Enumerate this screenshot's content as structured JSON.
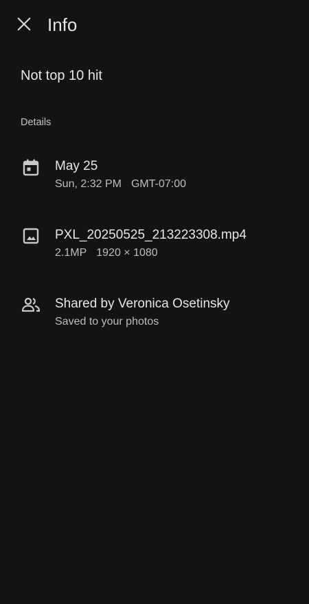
{
  "header": {
    "title": "Info",
    "close_icon": "close-icon"
  },
  "caption": "Not top 10 hit",
  "details": {
    "label": "Details",
    "date": {
      "icon": "calendar-icon",
      "primary": "May 25",
      "time": "Sun, 2:32 PM",
      "timezone": "GMT-07:00"
    },
    "file": {
      "icon": "image-icon",
      "primary": "PXL_20250525_213223308.mp4",
      "megapixels": "2.1MP",
      "resolution": "1920 × 1080"
    },
    "sharing": {
      "icon": "people-icon",
      "primary": "Shared by Veronica Osetinsky",
      "secondary": "Saved to your photos"
    }
  },
  "colors": {
    "background": "#131313",
    "text_primary": "#e6e6e6",
    "text_secondary": "#bdbdbd",
    "icon": "#c8c8c8"
  }
}
